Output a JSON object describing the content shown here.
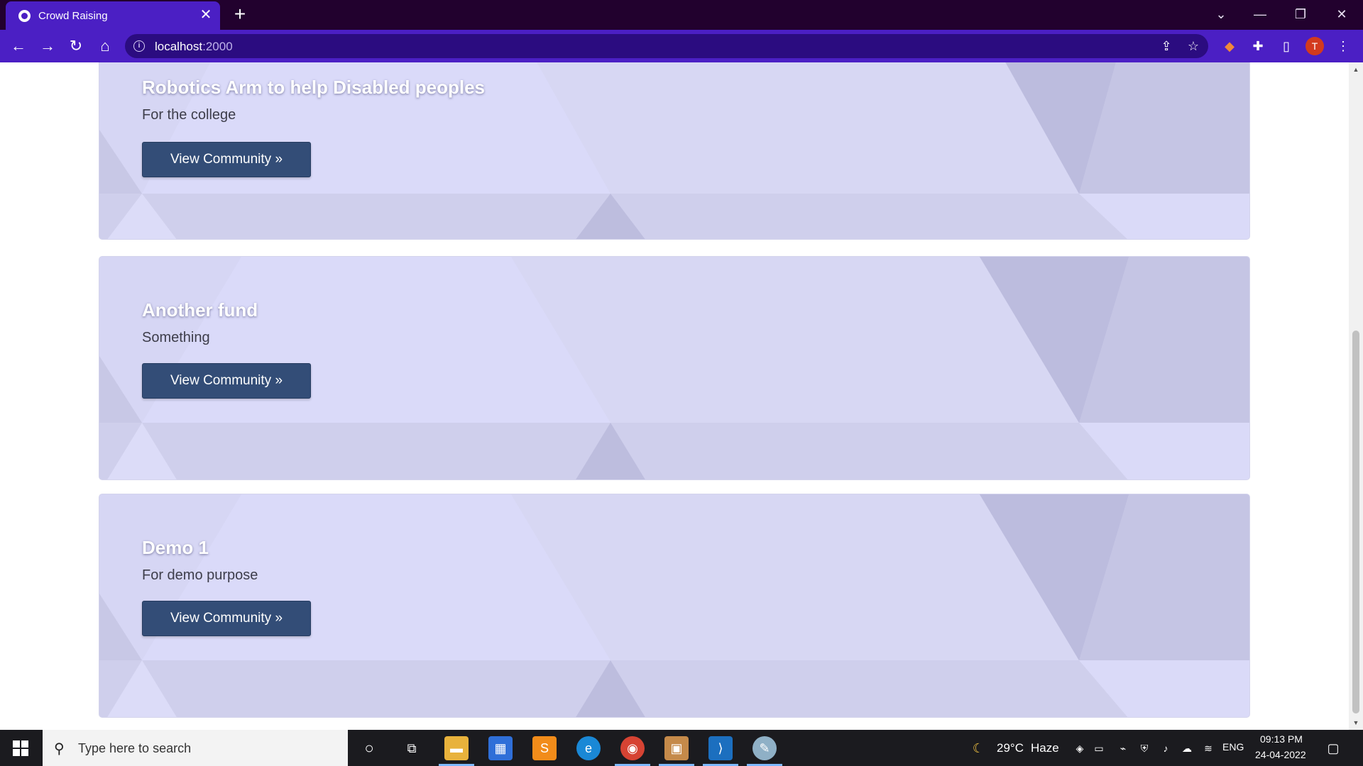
{
  "browser": {
    "tab_title": "Crowd Raising",
    "tab_close": "✕",
    "new_tab": "+",
    "url_host": "localhost",
    "url_port": ":2000",
    "avatar_letter": "T"
  },
  "cards": [
    {
      "title": "Robotics Arm to help Disabled peoples",
      "description": "For the college",
      "button_label": "View Community »"
    },
    {
      "title": "Another fund",
      "description": "Something",
      "button_label": "View Community »"
    },
    {
      "title": "Demo 1",
      "description": "For demo purpose",
      "button_label": "View Community »"
    }
  ],
  "taskbar": {
    "search_placeholder": "Type here to search",
    "weather_temp": "29°C",
    "weather_desc": "Haze",
    "language": "ENG",
    "time": "09:13 PM",
    "date": "24-04-2022"
  },
  "colors": {
    "browser_frame": "#22012e",
    "browser_toolbar": "#4b1fc4",
    "card_bg": "#d5d5f2",
    "button_bg": "#334d77"
  }
}
